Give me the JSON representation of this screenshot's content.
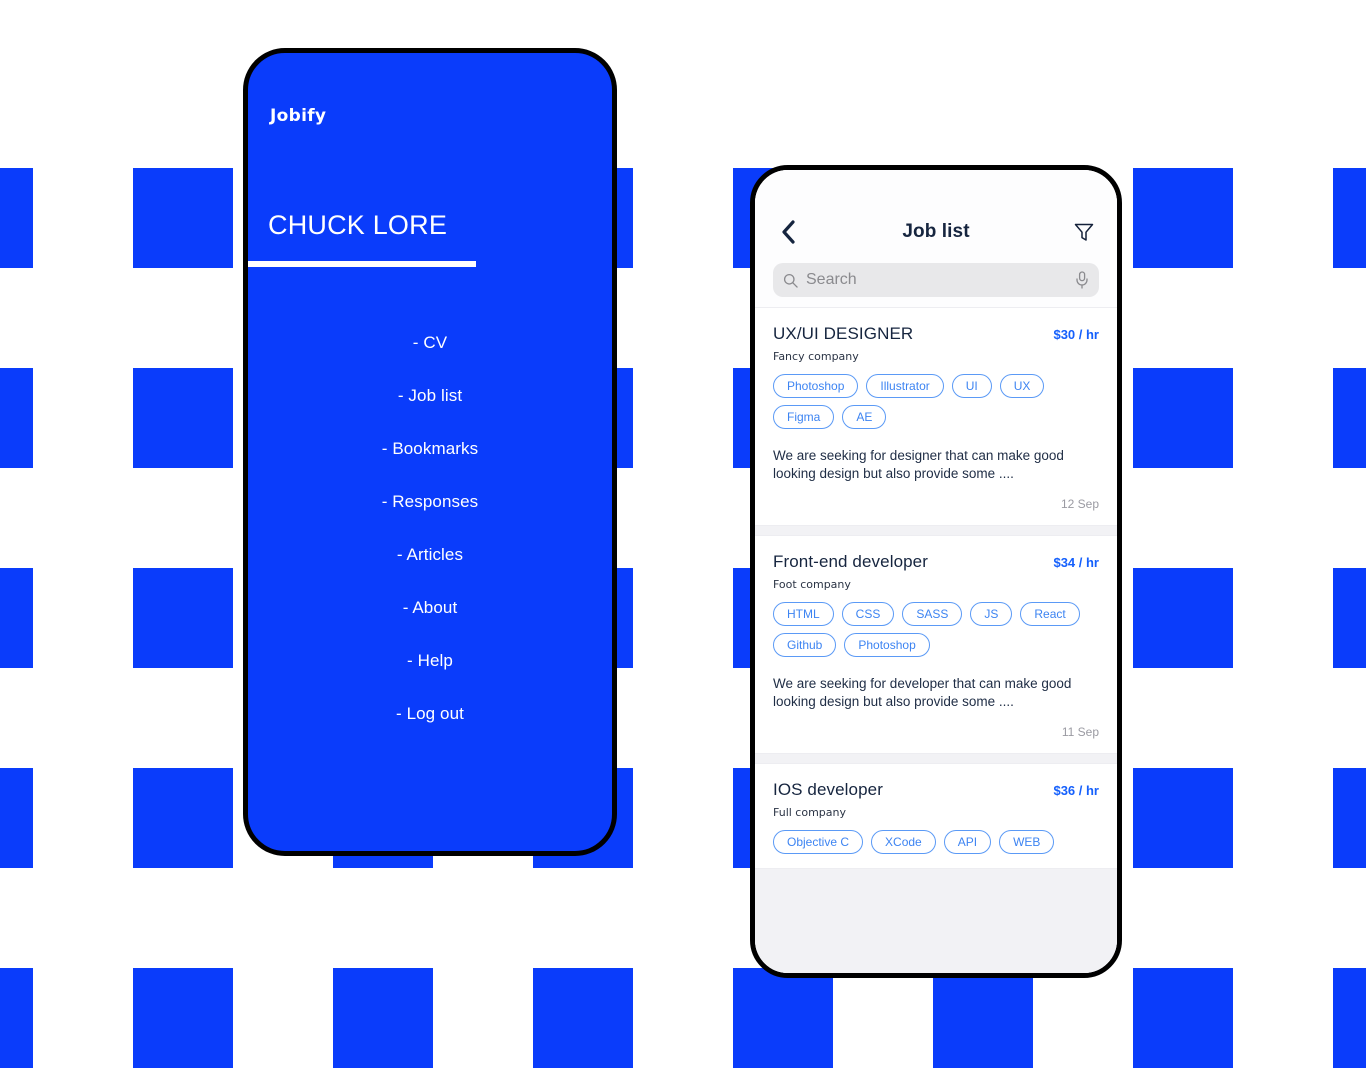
{
  "background": {
    "square_color": "#0A3CFB",
    "page_color": "#ffffff"
  },
  "menu_phone": {
    "brand": "Jobify",
    "profile_name": "CHUCK LORE",
    "accent_color": "#0A3CFB",
    "items": [
      {
        "label": "- CV",
        "name": "cv"
      },
      {
        "label": "- Job list",
        "name": "job-list"
      },
      {
        "label": "- Bookmarks",
        "name": "bookmarks"
      },
      {
        "label": "- Responses",
        "name": "responses"
      },
      {
        "label": "- Articles",
        "name": "articles"
      },
      {
        "label": "- About",
        "name": "about"
      },
      {
        "label": "- Help",
        "name": "help"
      },
      {
        "label": "- Log out",
        "name": "log-out"
      }
    ]
  },
  "joblist_phone": {
    "header": {
      "title": "Job list",
      "back_icon": "chevron-left-icon",
      "filter_icon": "filter-funnel-icon"
    },
    "search": {
      "placeholder": "Search",
      "value": "",
      "search_icon": "search-icon",
      "mic_icon": "microphone-icon"
    },
    "accent_color": "#1560FC",
    "tag_color": "#3D84F2",
    "jobs": [
      {
        "title": "UX/UI DESIGNER",
        "rate": "$30 / hr",
        "company": "Fancy company",
        "tags": [
          "Photoshop",
          "Illustrator",
          "UI",
          "UX",
          "Figma",
          "AE"
        ],
        "description": "We are seeking for designer that can make good looking design but also provide some ....",
        "date": "12 Sep"
      },
      {
        "title": "Front-end developer",
        "rate": "$34 / hr",
        "company": "Foot company",
        "tags": [
          "HTML",
          "CSS",
          "SASS",
          "JS",
          "React",
          "Github",
          "Photoshop"
        ],
        "description": "We are seeking for developer that can make good looking design but also provide some ....",
        "date": "11 Sep"
      },
      {
        "title": "IOS developer",
        "rate": "$36 / hr",
        "company": "Full company",
        "tags": [
          "Objective C",
          "XCode",
          "API",
          "WEB"
        ],
        "description": "",
        "date": ""
      }
    ]
  }
}
